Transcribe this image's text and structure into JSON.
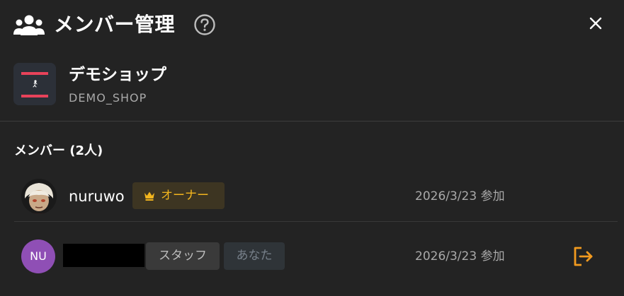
{
  "header": {
    "title": "メンバー管理",
    "icon": "users-icon",
    "help_icon": "help-circle-icon",
    "close_icon": "close-icon"
  },
  "shop": {
    "name": "デモショップ",
    "code": "DEMO_SHOP",
    "logo_text": "テカラの技術"
  },
  "members": {
    "heading": "メンバー (2人)",
    "list": [
      {
        "name": "nuruwo",
        "role": "オーナー",
        "role_icon": "crown-icon",
        "joined": "2026/3/23 参加",
        "avatar": "photo"
      },
      {
        "initials": "NU",
        "name_redacted": true,
        "role": "スタッフ",
        "you_label": "あなた",
        "joined": "2026/3/23 参加",
        "action_icon": "leave-icon"
      }
    ]
  },
  "colors": {
    "background": "#232323",
    "owner_accent": "#f2b51e",
    "leave_accent": "#f29a1f",
    "avatar_purple": "#8f4fb5"
  }
}
